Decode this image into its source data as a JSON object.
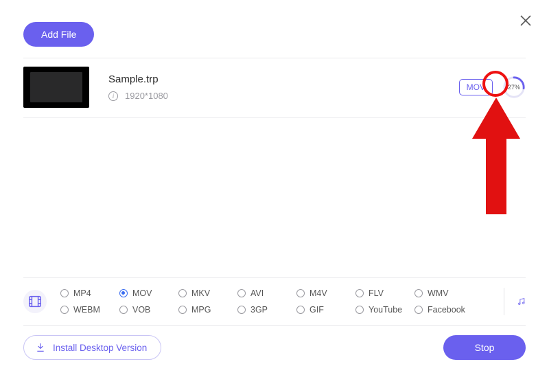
{
  "header": {
    "add_file_label": "Add File"
  },
  "file": {
    "name": "Sample.trp",
    "resolution": "1920*1080",
    "target_format": "MOV",
    "progress_pct": 27,
    "progress_label": "27%"
  },
  "formats": {
    "selected": "MOV",
    "row1": [
      "MP4",
      "MOV",
      "MKV",
      "AVI",
      "M4V",
      "FLV",
      "WMV"
    ],
    "row2": [
      "WEBM",
      "VOB",
      "MPG",
      "3GP",
      "GIF",
      "YouTube",
      "Facebook"
    ]
  },
  "footer": {
    "install_label": "Install Desktop Version",
    "stop_label": "Stop"
  },
  "colors": {
    "accent": "#6a60ee",
    "callout": "#e11111"
  }
}
